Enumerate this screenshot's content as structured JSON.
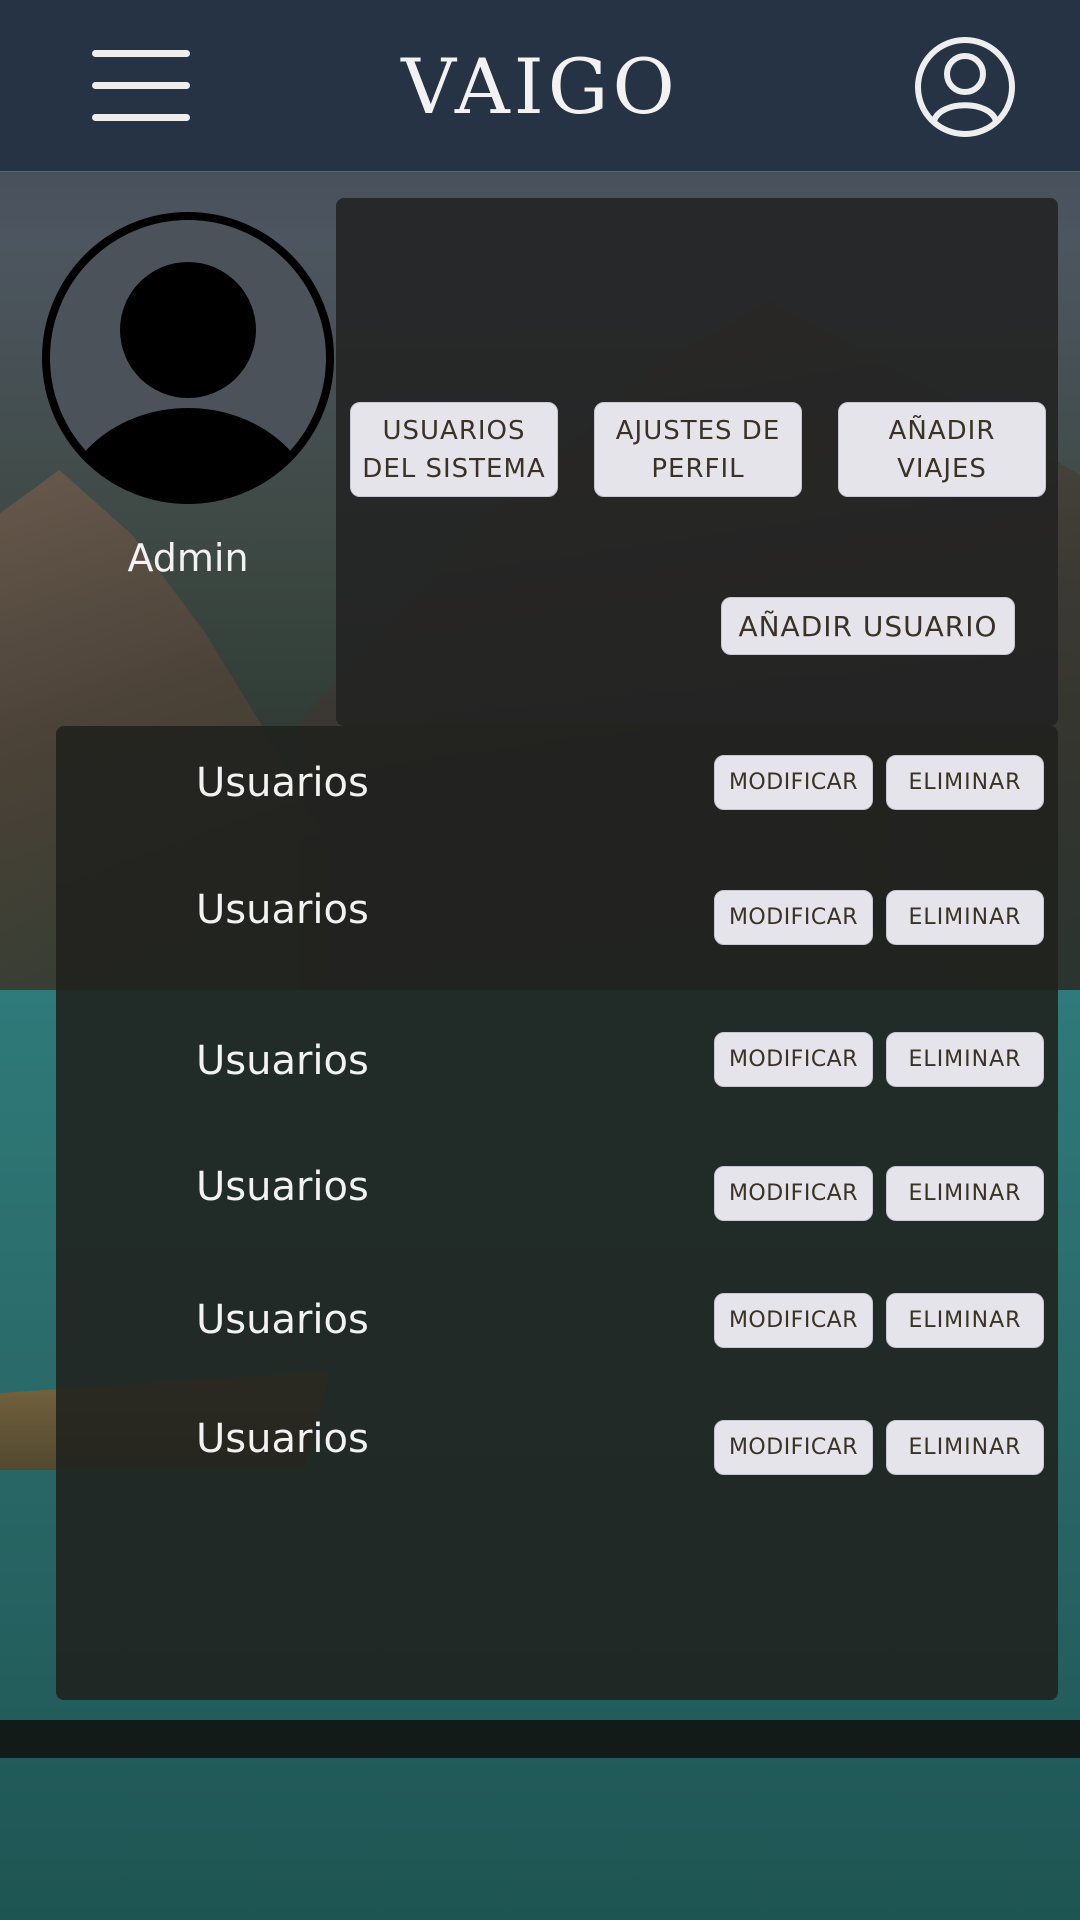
{
  "header": {
    "brand": "VAIGO",
    "menu_icon": "hamburger-menu-icon",
    "profile_icon": "user-circle-icon"
  },
  "profile": {
    "avatar_icon": "user-avatar-icon",
    "name": "Admin"
  },
  "nav_buttons": [
    {
      "label": "USUARIOS DEL SISTEMA"
    },
    {
      "label": "AJUSTES DE PERFIL"
    },
    {
      "label": "AÑADIR VIAJES"
    }
  ],
  "add_user_label": "AÑADIR USUARIO",
  "users": [
    {
      "label": "Usuarios",
      "modify": "MODIFICAR",
      "delete": "ELIMINAR"
    },
    {
      "label": "Usuarios",
      "modify": "MODIFICAR",
      "delete": "ELIMINAR"
    },
    {
      "label": "Usuarios",
      "modify": "MODIFICAR",
      "delete": "ELIMINAR"
    },
    {
      "label": "Usuarios",
      "modify": "MODIFICAR",
      "delete": "ELIMINAR"
    },
    {
      "label": "Usuarios",
      "modify": "MODIFICAR",
      "delete": "ELIMINAR"
    },
    {
      "label": "Usuarios",
      "modify": "MODIFICAR",
      "delete": "ELIMINAR"
    }
  ],
  "colors": {
    "header_bg": "#263344",
    "button_bg": "#e4e4ea",
    "button_text": "#3a3226",
    "panel_bg": "#222222"
  }
}
